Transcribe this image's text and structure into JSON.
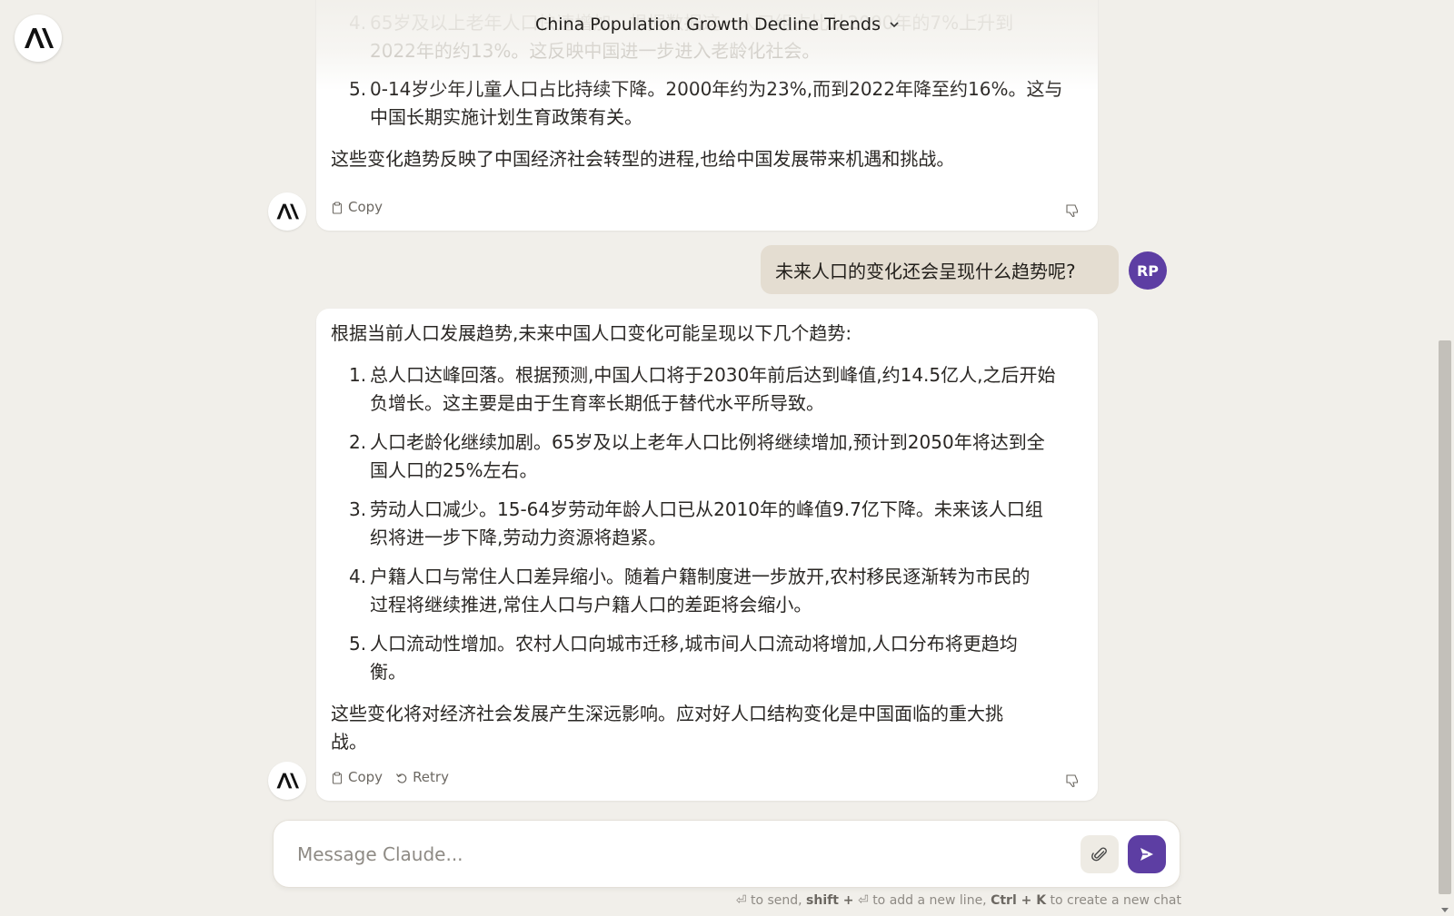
{
  "app": {
    "title": "China Population Growth Decline Trends"
  },
  "conversation": {
    "ai_message_1": {
      "items": [
        {
          "num": "4.",
          "lines": [
            "65岁及以上老年人口快速增加。根据数据这一人口组占比从2000年的7%上升到",
            "2022年的约13%。这反映中国进一步进入老龄化社会。"
          ]
        },
        {
          "num": "5.",
          "lines": [
            "0-14岁少年儿童人口占比持续下降。2000年约为23%,而到2022年降至约16%。这与",
            "中国长期实施计划生育政策有关。"
          ]
        }
      ],
      "closing": "这些变化趋势反映了中国经济社会转型的进程,也给中国发展带来机遇和挑战。",
      "copy_label": "Copy"
    },
    "user_message": {
      "text": "未来人口的变化还会呈现什么趋势呢?",
      "avatar": "RP"
    },
    "ai_message_2": {
      "intro": "根据当前人口发展趋势,未来中国人口变化可能呈现以下几个趋势:",
      "items": [
        {
          "num": "1.",
          "lines": [
            "总人口达峰回落。根据预测,中国人口将于2030年前后达到峰值,约14.5亿人,之后开始",
            "负增长。这主要是由于生育率长期低于替代水平所导致。"
          ]
        },
        {
          "num": "2.",
          "lines": [
            "人口老龄化继续加剧。65岁及以上老年人口比例将继续增加,预计到2050年将达到全",
            "国人口的25%左右。"
          ]
        },
        {
          "num": "3.",
          "lines": [
            "劳动人口减少。15-64岁劳动年龄人口已从2010年的峰值9.7亿下降。未来该人口组",
            "织将进一步下降,劳动力资源将趋紧。"
          ]
        },
        {
          "num": "4.",
          "lines": [
            "户籍人口与常住人口差异缩小。随着户籍制度进一步放开,农村移民逐渐转为市民的",
            "过程将继续推进,常住人口与户籍人口的差距将会缩小。"
          ]
        },
        {
          "num": "5.",
          "lines": [
            "人口流动性增加。农村人口向城市迁移,城市间人口流动将增加,人口分布将更趋均",
            "衡。"
          ]
        }
      ],
      "closing_lines": [
        "这些变化将对经济社会发展产生深远影响。应对好人口结构变化是中国面临的重大挑",
        "战。"
      ],
      "copy_label": "Copy",
      "retry_label": "Retry"
    }
  },
  "composer": {
    "placeholder": "Message Claude..."
  },
  "hint": {
    "part1": "to send,",
    "shift": "shift +",
    "part2": "to add a new line,",
    "ctrl_k": "Ctrl + K",
    "part3": "to create a new chat"
  },
  "colors": {
    "accent": "#5d3ea3",
    "background": "#f1efea",
    "user_bubble": "#e4ddd1"
  }
}
